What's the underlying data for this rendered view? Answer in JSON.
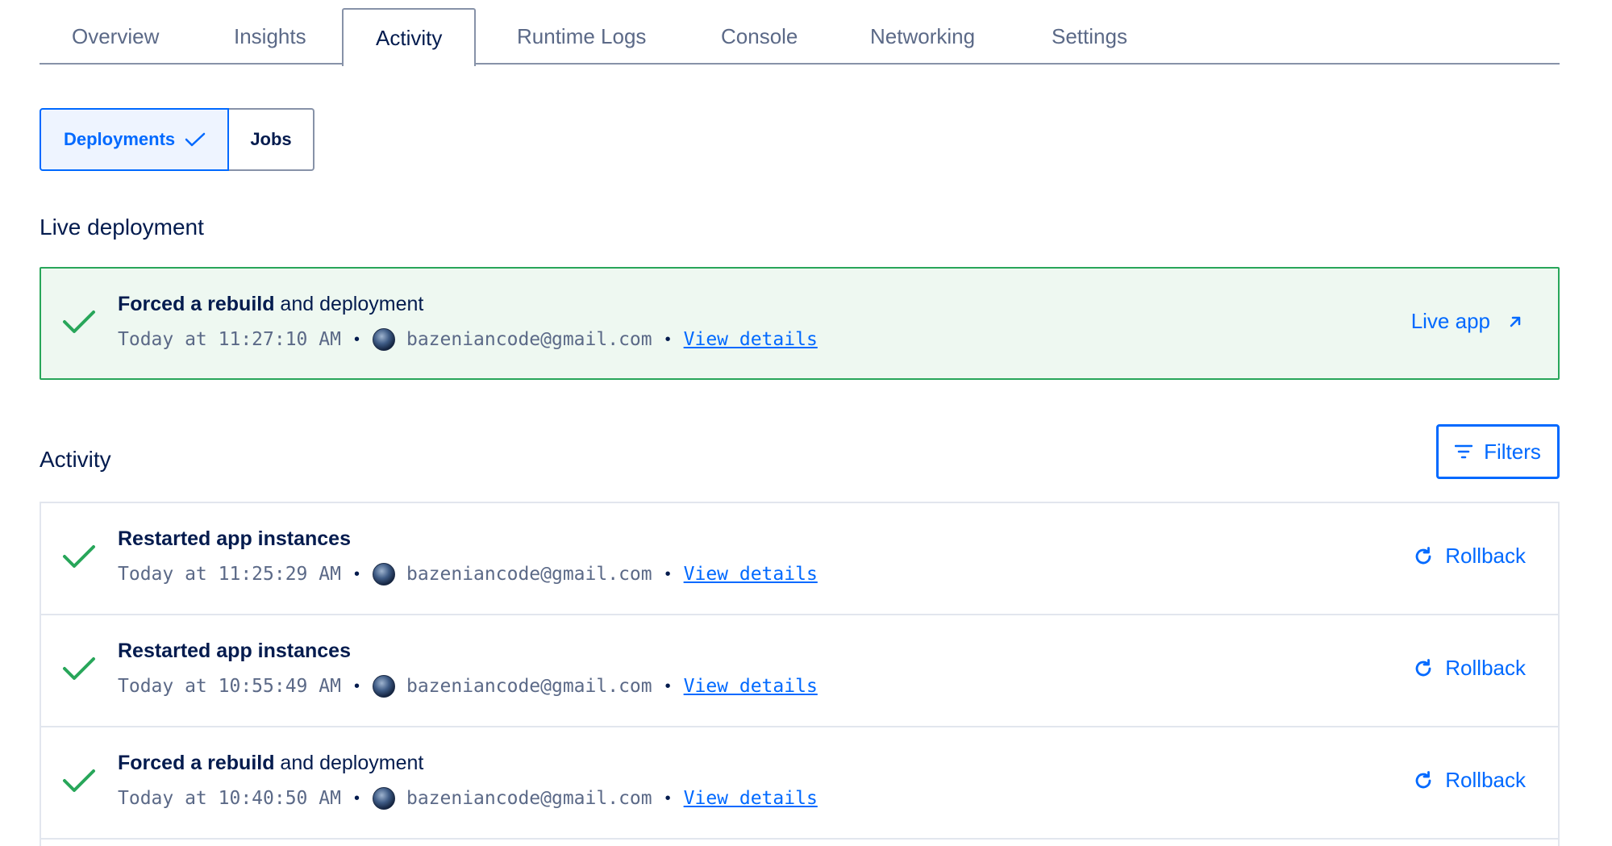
{
  "tabs": [
    {
      "label": "Overview"
    },
    {
      "label": "Insights"
    },
    {
      "label": "Activity"
    },
    {
      "label": "Runtime Logs"
    },
    {
      "label": "Console"
    },
    {
      "label": "Networking"
    },
    {
      "label": "Settings"
    }
  ],
  "active_tab": "Activity",
  "subtabs": {
    "deployments": "Deployments",
    "jobs": "Jobs"
  },
  "live": {
    "heading": "Live deployment",
    "title_bold": "Forced a rebuild",
    "title_rest": " and deployment",
    "time": "Today at 11:27:10 AM",
    "user": "bazeniancode@gmail.com",
    "details": "View details",
    "live_app": "Live app"
  },
  "activity": {
    "heading": "Activity",
    "filters": "Filters",
    "rows": [
      {
        "title_bold": "Restarted app instances",
        "title_rest": "",
        "time": "Today at 11:25:29 AM",
        "user": "bazeniancode@gmail.com",
        "details": "View details",
        "action": "Rollback"
      },
      {
        "title_bold": "Restarted app instances",
        "title_rest": "",
        "time": "Today at 10:55:49 AM",
        "user": "bazeniancode@gmail.com",
        "details": "View details",
        "action": "Rollback"
      },
      {
        "title_bold": "Forced a rebuild",
        "title_rest": " and deployment",
        "time": "Today at 10:40:50 AM",
        "user": "bazeniancode@gmail.com",
        "details": "View details",
        "action": "Rollback"
      }
    ]
  },
  "separator": "•",
  "icons": {
    "success": "check-icon",
    "external": "external-link-icon",
    "filter": "filter-icon",
    "rollback": "rollback-icon"
  },
  "colors": {
    "accent": "#0069ff",
    "success": "#28a65a",
    "live_bg": "#eef8f1",
    "text": "#031b4e",
    "muted": "#5b6987"
  }
}
